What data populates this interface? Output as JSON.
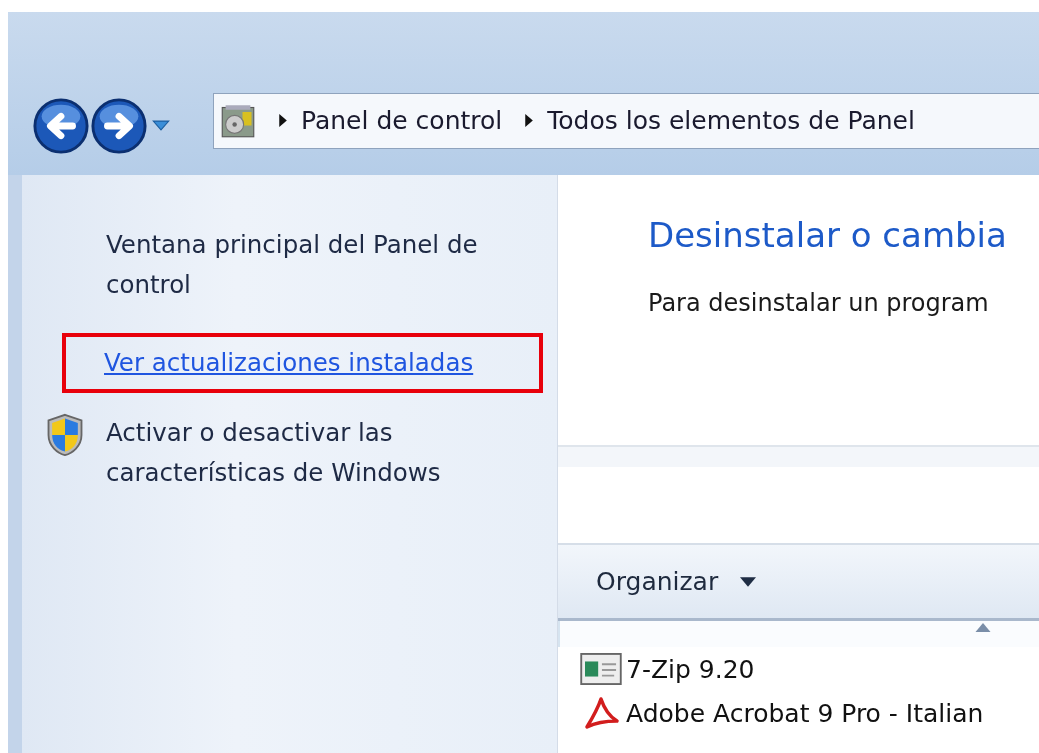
{
  "address_bar": {
    "crumbs": [
      "Panel de control",
      "Todos los elementos de Panel"
    ]
  },
  "sidebar": {
    "items": [
      {
        "kind": "plain",
        "label": "Ventana principal del Panel de control",
        "highlighted": false
      },
      {
        "kind": "link",
        "label": "Ver actualizaciones instaladas",
        "highlighted": true
      },
      {
        "kind": "shield",
        "label": "Activar o desactivar las características de Windows",
        "highlighted": false
      }
    ]
  },
  "content": {
    "heading": "Desinstalar o cambia",
    "description": "Para desinstalar un program"
  },
  "toolbar": {
    "organize_button": "Organizar"
  },
  "programs": [
    {
      "kind": "app",
      "name": "7-Zip 9.20"
    },
    {
      "kind": "pdf",
      "name": "Adobe Acrobat 9 Pro - Italian"
    }
  ]
}
